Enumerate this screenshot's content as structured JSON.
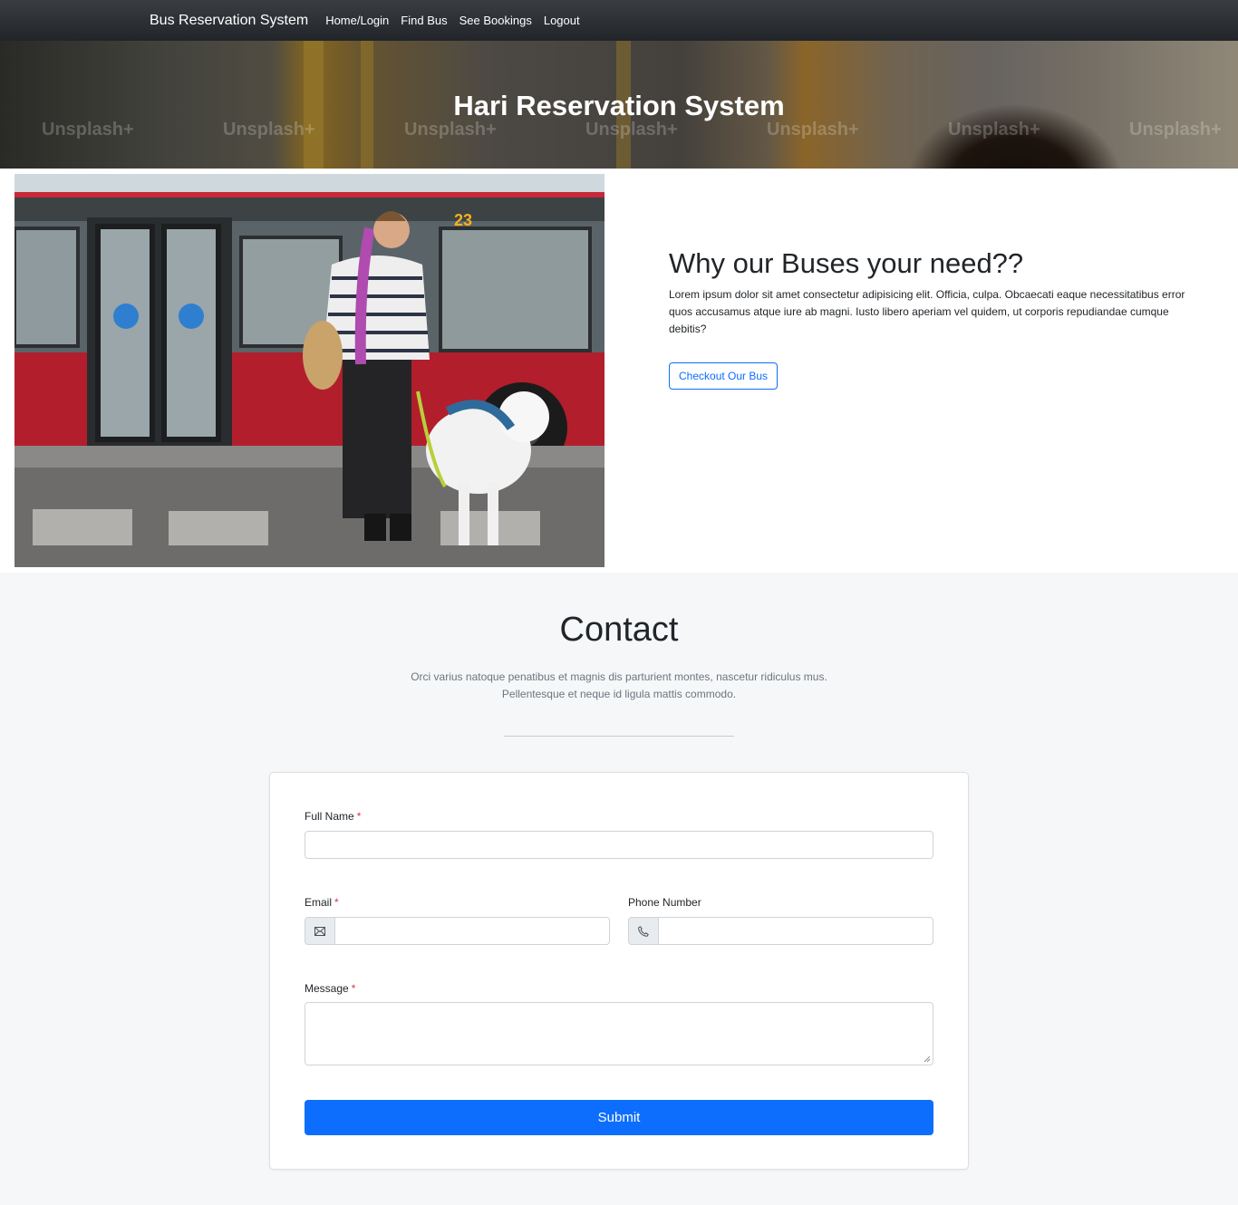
{
  "navbar": {
    "brand": "Bus Reservation System",
    "links": [
      "Home/Login",
      "Find Bus",
      "See Bookings",
      "Logout"
    ]
  },
  "hero": {
    "title": "Hari Reservation System",
    "watermarks": [
      "Unsplash+",
      "Unsplash+",
      "Unsplash+",
      "Unsplash+",
      "Unsplash+",
      "Unsplash+",
      "Unsplash+"
    ]
  },
  "about": {
    "heading": "Why our Buses your need??",
    "body": "Lorem ipsum dolor sit amet consectetur adipisicing elit. Officia, culpa. Obcaecati eaque necessitatibus error quos accusamus atque iure ab magni. Iusto libero aperiam vel quidem, ut corporis repudiandae cumque debitis?",
    "button": "Checkout Our Bus",
    "bus_number": "23"
  },
  "contact": {
    "title": "Contact",
    "lead_line1": "Orci varius natoque penatibus et magnis dis parturient montes, nascetur ridiculus mus.",
    "lead_line2": "Pellentesque et neque id ligula mattis commodo.",
    "form": {
      "full_name_label": "Full Name",
      "full_name_value": "",
      "email_label": "Email",
      "email_value": "",
      "phone_label": "Phone Number",
      "phone_value": "",
      "message_label": "Message",
      "message_value": "",
      "required_mark": "*",
      "submit_label": "Submit"
    }
  },
  "colors": {
    "primary": "#0d6efd",
    "required": "#dc3545",
    "navbar": "#212529",
    "section_bg": "#f6f7f9"
  },
  "icons": {
    "email_addon": "envelope-icon",
    "phone_addon": "telephone-icon"
  }
}
